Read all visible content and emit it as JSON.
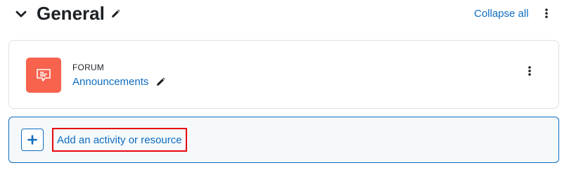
{
  "section": {
    "title": "General",
    "collapse_all_label": "Collapse all"
  },
  "activity": {
    "type_label": "FORUM",
    "name": "Announcements",
    "icon": "forum-icon",
    "icon_bg_color": "#f7634d"
  },
  "add_activity": {
    "label": "Add an activity or resource"
  },
  "colors": {
    "link": "#0f6cbf",
    "highlight_border": "#e8080d"
  }
}
